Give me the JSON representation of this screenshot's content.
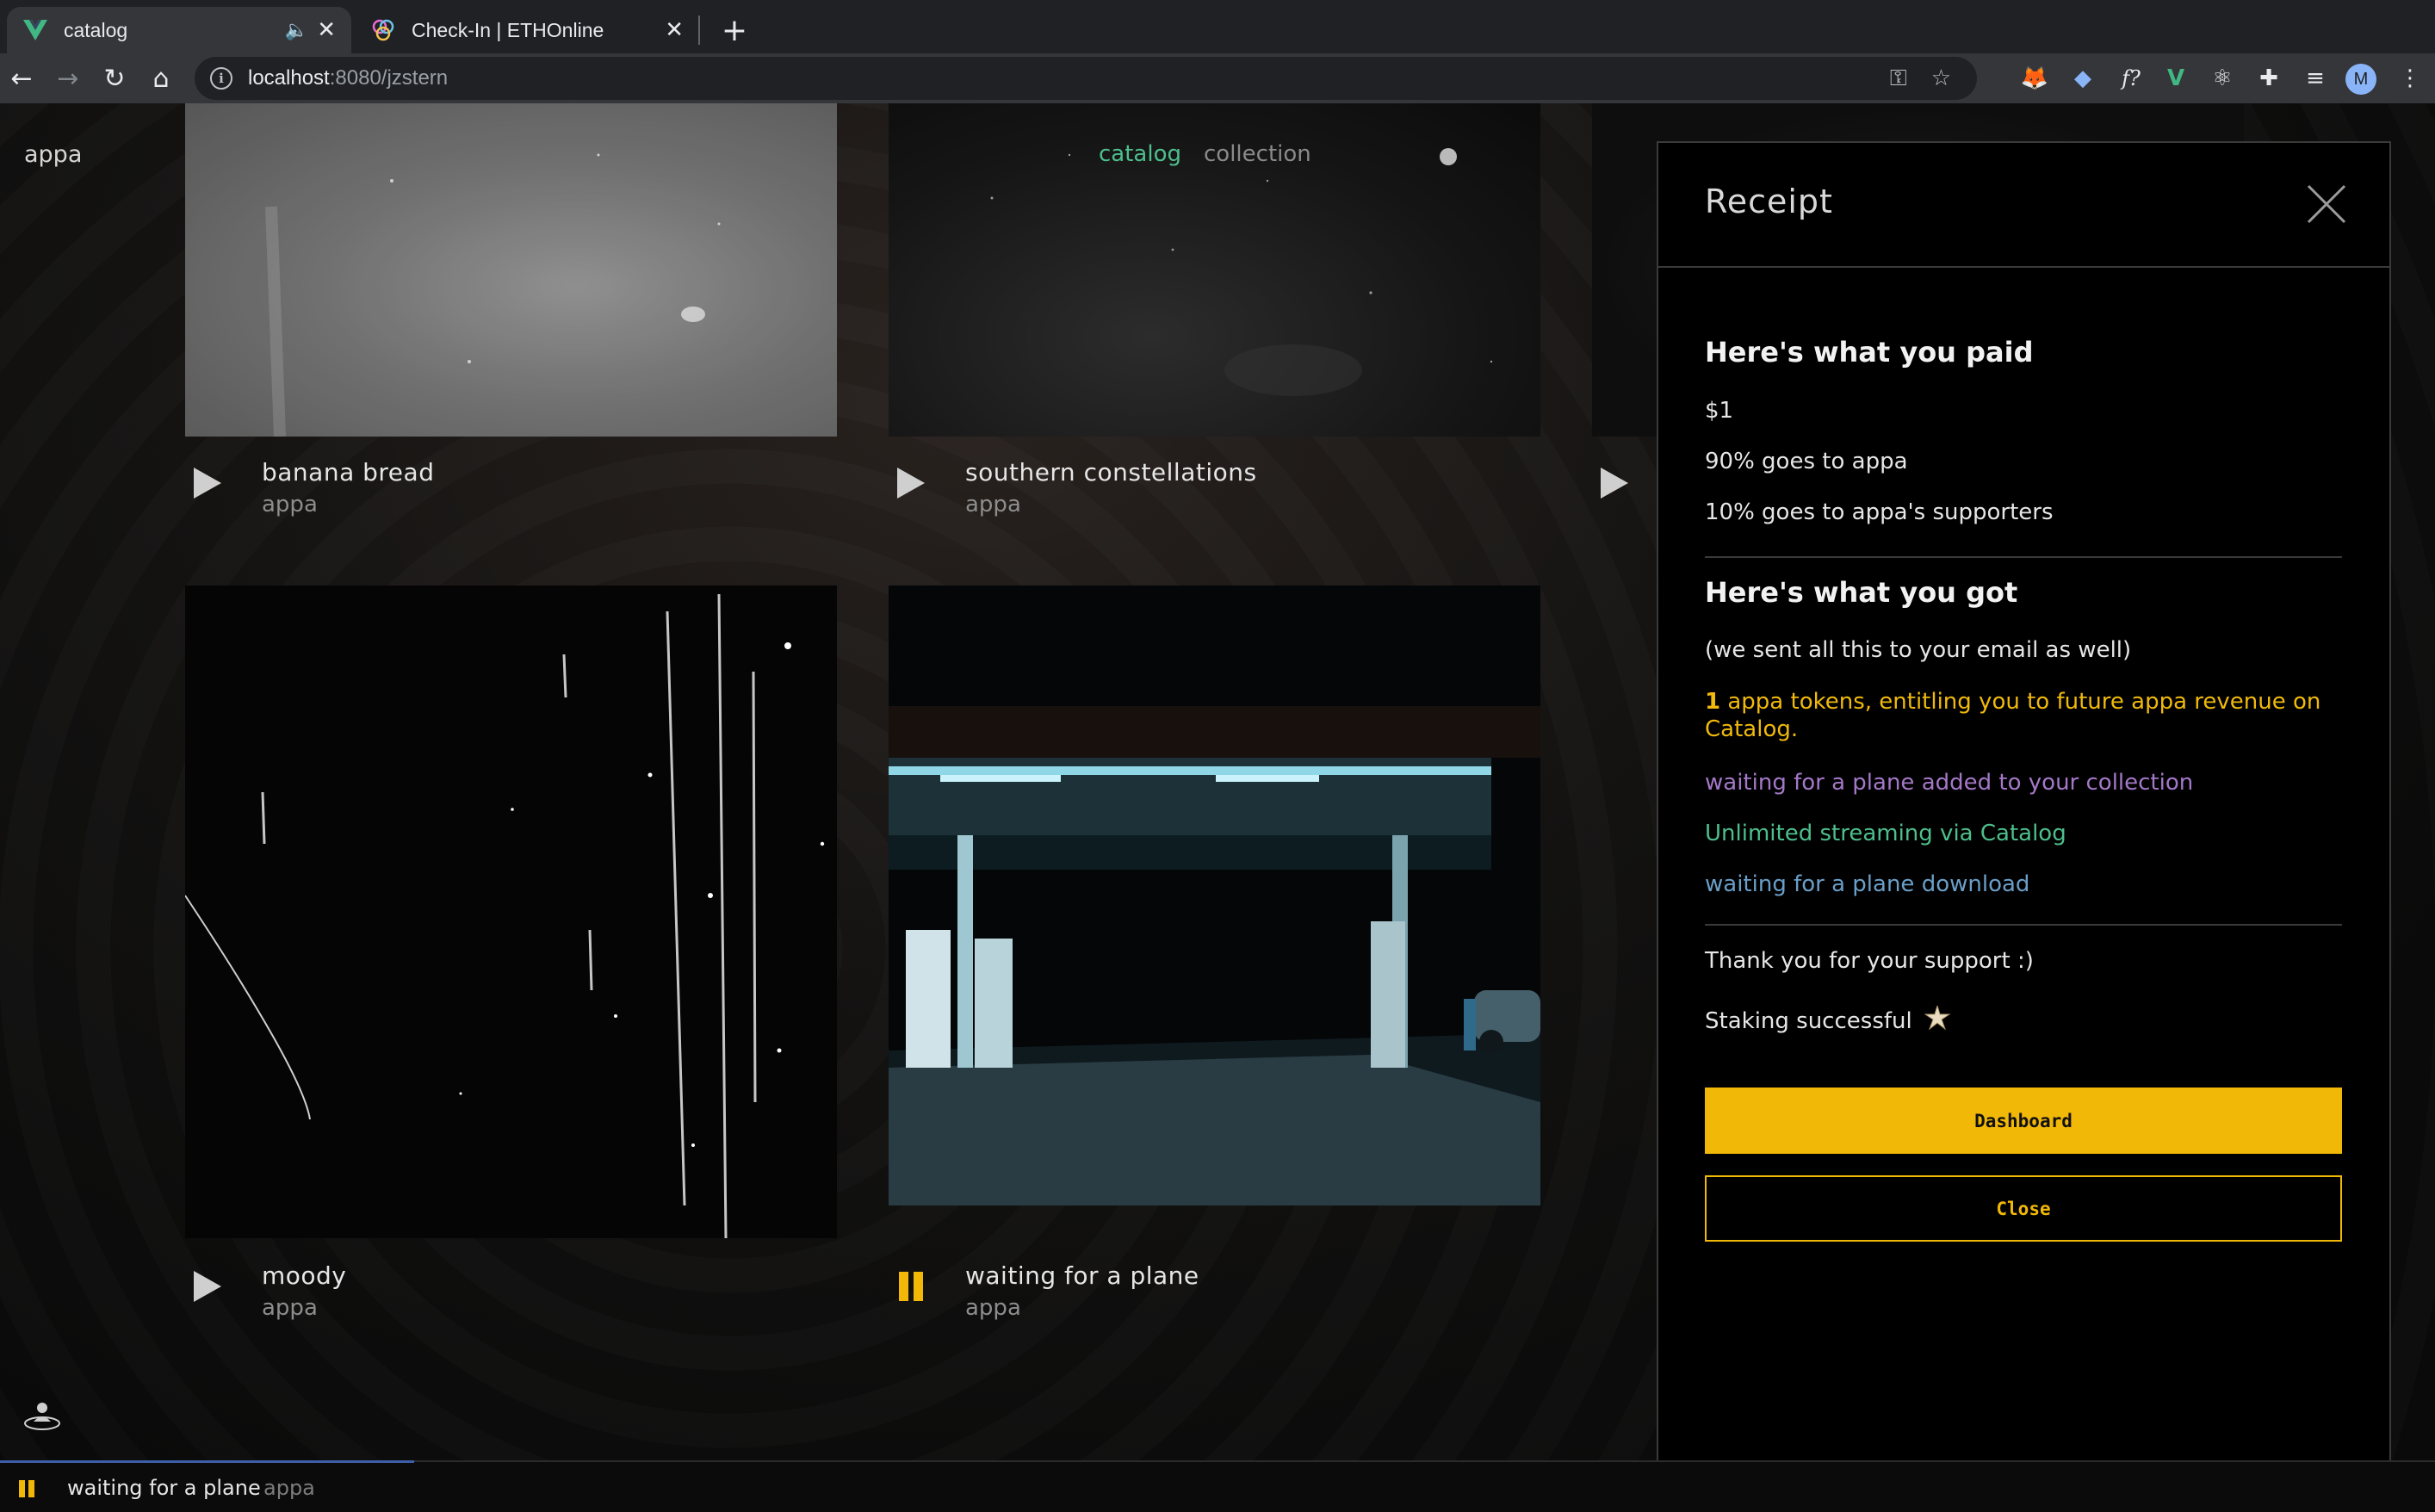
{
  "browser": {
    "tabs": [
      {
        "title": "catalog",
        "active": true,
        "favicon": "vue-icon",
        "audio": true
      },
      {
        "title": "Check-In | ETHOnline",
        "active": false,
        "favicon": "ethonline-icon"
      }
    ],
    "url_host": "localhost",
    "url_path": ":8080/jzstern",
    "profile_initial": "M"
  },
  "app": {
    "brand": "appa",
    "nav": {
      "catalog": "catalog",
      "collection": "collection"
    }
  },
  "cards": [
    {
      "title": "banana bread",
      "artist": "appa",
      "state": "paused"
    },
    {
      "title": "southern constellations",
      "artist": "appa",
      "state": "paused"
    },
    {
      "title": "moody",
      "artist": "appa",
      "state": "paused"
    },
    {
      "title": "waiting for a plane",
      "artist": "appa",
      "state": "playing"
    }
  ],
  "receipt": {
    "title": "Receipt",
    "paid_heading": "Here's what you paid",
    "amount": "$1",
    "split_artist": "90% goes to appa",
    "split_supporters": "10% goes to appa's supporters",
    "got_heading": "Here's what you got",
    "email_note": "(we sent all this to your email as well)",
    "token_count": "1",
    "token_text": " appa tokens, entitling you to future appa revenue on Catalog.",
    "collection_text": "waiting for a plane added to your collection",
    "streaming_text": "Unlimited streaming via Catalog",
    "download_text": "waiting for a plane download",
    "thanks": "Thank you for your support :)",
    "staking": "Staking successful",
    "dashboard_label": "Dashboard",
    "close_label": "Close"
  },
  "player": {
    "title": "waiting for a plane",
    "artist": "appa",
    "progress": 0.17
  },
  "colors": {
    "accent_gold": "#f2b807",
    "accent_green": "#4dbf8c",
    "purple": "#a478c8",
    "blue": "#6a9fc9"
  }
}
